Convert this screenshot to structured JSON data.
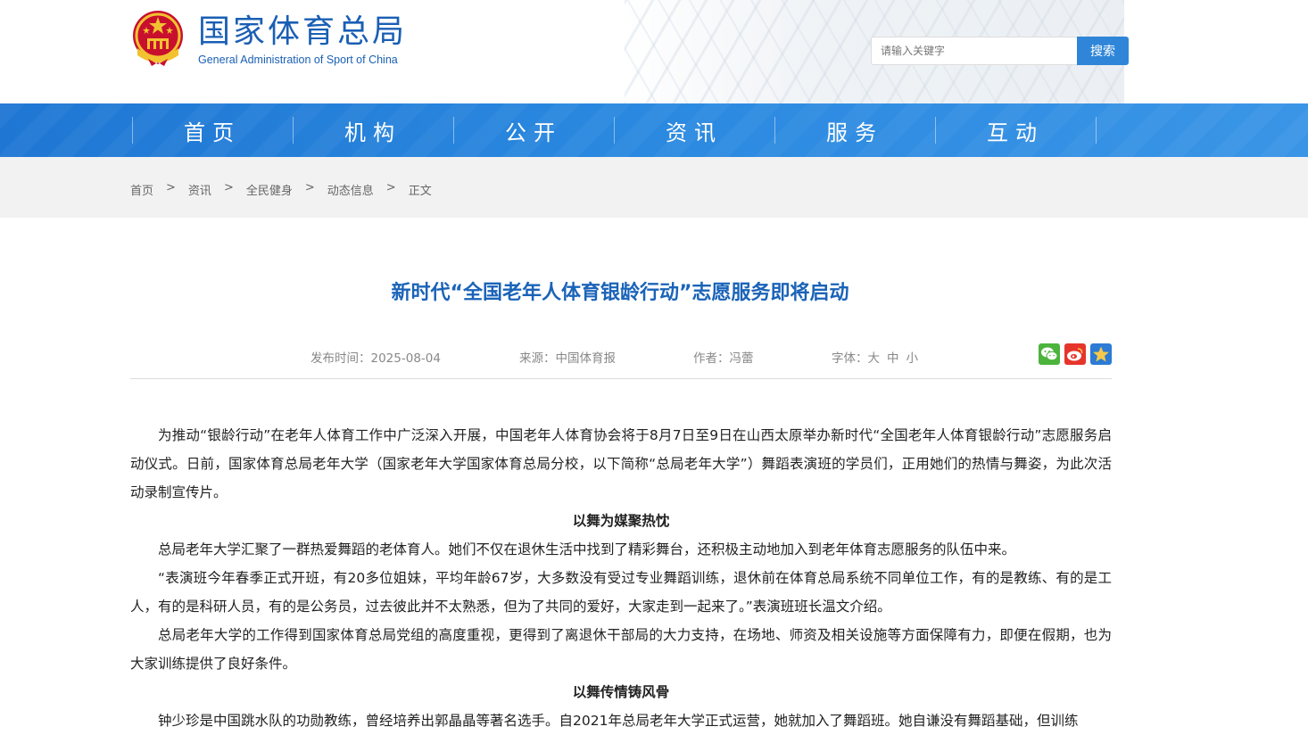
{
  "header": {
    "site_name_cn": "国家体育总局",
    "site_name_en": "General Administration of Sport of China",
    "search_placeholder": "请输入关键字",
    "search_button": "搜索"
  },
  "nav": {
    "items": [
      "首页",
      "机构",
      "公开",
      "资讯",
      "服务",
      "互动"
    ]
  },
  "breadcrumb": {
    "items": [
      "首页",
      "资讯",
      "全民健身",
      "动态信息",
      "正文"
    ],
    "separator": ">"
  },
  "article": {
    "title": "新时代“全国老年人体育银龄行动”志愿服务即将启动",
    "meta": {
      "publish_label": "发布时间：",
      "publish_date": "2025-08-04",
      "source_label": "来源：",
      "source": "中国体育报",
      "author_label": "作者：",
      "author": "冯蕾",
      "font_label": "字体：",
      "font_large": "大",
      "font_medium": "中",
      "font_small": "小"
    },
    "share_icons": [
      "wechat-icon",
      "weibo-icon",
      "favorite-icon"
    ],
    "paragraphs": [
      "为推动“银龄行动”在老年人体育工作中广泛深入开展，中国老年人体育协会将于8月7日至9日在山西太原举办新时代“全国老年人体育银龄行动”志愿服务启动仪式。日前，国家体育总局老年大学（国家老年大学国家体育总局分校，以下简称“总局老年大学”）舞蹈表演班的学员们，正用她们的热情与舞姿，为此次活动录制宣传片。",
      "以舞为媒聚热忱",
      "总局老年大学汇聚了一群热爱舞蹈的老体育人。她们不仅在退休生活中找到了精彩舞台，还积极主动地加入到老年体育志愿服务的队伍中来。",
      "“表演班今年春季正式开班，有20多位姐妹，平均年龄67岁，大多数没有受过专业舞蹈训练，退休前在体育总局系统不同单位工作，有的是教练、有的是工人，有的是科研人员，有的是公务员，过去彼此并不太熟悉，但为了共同的爱好，大家走到一起来了。”表演班班长温文介绍。",
      "总局老年大学的工作得到国家体育总局党组的高度重视，更得到了离退休干部局的大力支持，在场地、师资及相关设施等方面保障有力，即便在假期，也为大家训练提供了良好条件。",
      "以舞传情铸风骨",
      "钟少珍是中国跳水队的功勋教练，曾经培养出郭晶晶等著名选手。自2021年总局老年大学正式运营，她就加入了舞蹈班。她自谦没有舞蹈基础，但训练"
    ]
  },
  "colors": {
    "brand_blue": "#1a5fb4",
    "nav_blue": "#2b89e0",
    "title_blue": "#1a63b8",
    "search_button": "#2f86d8"
  }
}
